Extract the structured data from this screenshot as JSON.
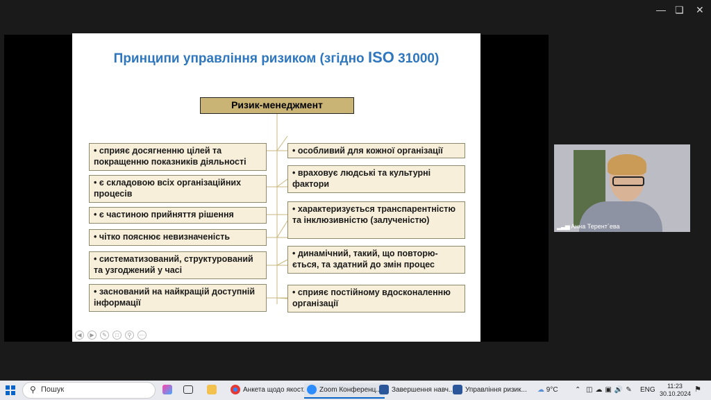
{
  "slide": {
    "title_prefix": "Принципи управління ризиком (згідно ",
    "title_iso": "ISO",
    "title_suffix": " 31000)",
    "center_label": "Ризик-менеджмент",
    "left_items": [
      "• сприяє досягненню цілей та покращенню показників діяльності",
      "• є складовою всіх організаційних процесів",
      "• є частиною прийняття рішення",
      "• чітко пояснює невизначеність",
      "• систематизований, структурований та узгоджений у часі",
      "• заснований на найкращій доступній інформації"
    ],
    "right_items": [
      "• особливий для кожної організації",
      "• враховує людські та культурні фактори",
      "• характеризується транспарентністю та інклюзивністю (залученістю)",
      "• динамічний, такий, що повторю-ється, та здатний до змін процес",
      "• сприяє постійному вдосконаленню організації"
    ]
  },
  "participant": {
    "name": "Анна Терент`ева"
  },
  "taskbar": {
    "search_label": "Пошук",
    "apps": [
      "Анкета щодо якост...",
      "Zoom Конференц...",
      "Завершення навч...",
      "Управління ризик..."
    ],
    "weather": "9°C",
    "lang": "ENG",
    "time": "11:23",
    "date": "30.10.2024"
  },
  "colors": {
    "title": "#2e76bd",
    "box_fill": "#f7efd9",
    "center_fill": "#c9b475",
    "taskbar": "#e8eaef"
  }
}
